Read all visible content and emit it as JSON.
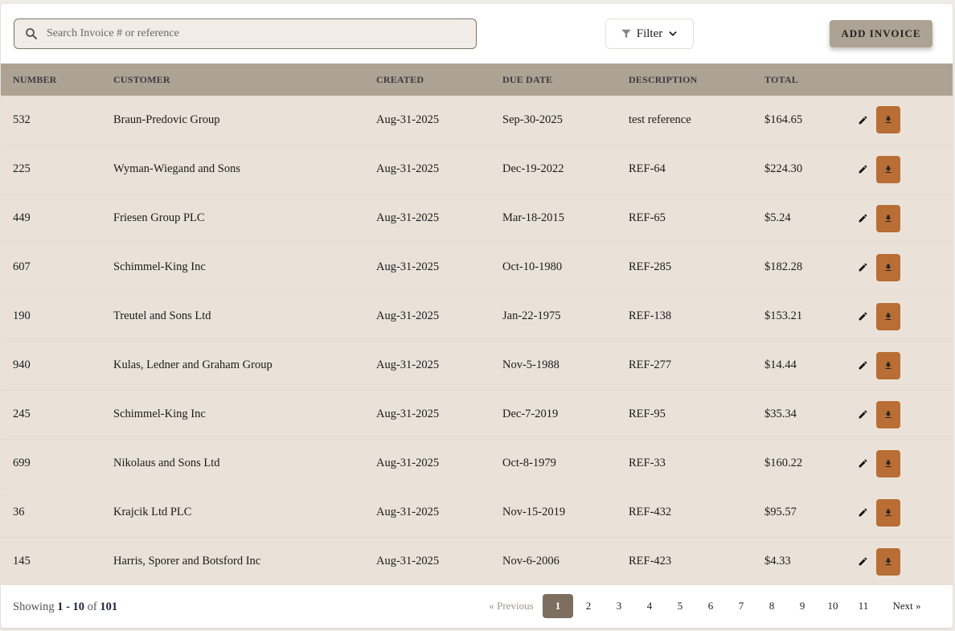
{
  "toolbar": {
    "search_placeholder": "Search Invoice # or reference",
    "filter_label": "Filter",
    "add_label": "ADD INVOICE"
  },
  "table": {
    "headers": [
      "NUMBER",
      "CUSTOMER",
      "CREATED",
      "DUE DATE",
      "DESCRIPTION",
      "TOTAL"
    ],
    "rows": [
      {
        "number": "532",
        "customer": "Braun-Predovic Group",
        "created": "Aug-31-2025",
        "due": "Sep-30-2025",
        "description": "test reference",
        "total": "$164.65"
      },
      {
        "number": "225",
        "customer": "Wyman-Wiegand and Sons",
        "created": "Aug-31-2025",
        "due": "Dec-19-2022",
        "description": "REF-64",
        "total": "$224.30"
      },
      {
        "number": "449",
        "customer": "Friesen Group PLC",
        "created": "Aug-31-2025",
        "due": "Mar-18-2015",
        "description": "REF-65",
        "total": "$5.24"
      },
      {
        "number": "607",
        "customer": "Schimmel-King Inc",
        "created": "Aug-31-2025",
        "due": "Oct-10-1980",
        "description": "REF-285",
        "total": "$182.28"
      },
      {
        "number": "190",
        "customer": "Treutel and Sons Ltd",
        "created": "Aug-31-2025",
        "due": "Jan-22-1975",
        "description": "REF-138",
        "total": "$153.21"
      },
      {
        "number": "940",
        "customer": "Kulas, Ledner and Graham Group",
        "created": "Aug-31-2025",
        "due": "Nov-5-1988",
        "description": "REF-277",
        "total": "$14.44"
      },
      {
        "number": "245",
        "customer": "Schimmel-King Inc",
        "created": "Aug-31-2025",
        "due": "Dec-7-2019",
        "description": "REF-95",
        "total": "$35.34"
      },
      {
        "number": "699",
        "customer": "Nikolaus and Sons Ltd",
        "created": "Aug-31-2025",
        "due": "Oct-8-1979",
        "description": "REF-33",
        "total": "$160.22"
      },
      {
        "number": "36",
        "customer": "Krajcik Ltd PLC",
        "created": "Aug-31-2025",
        "due": "Nov-15-2019",
        "description": "REF-432",
        "total": "$95.57"
      },
      {
        "number": "145",
        "customer": "Harris, Sporer and Botsford Inc",
        "created": "Aug-31-2025",
        "due": "Nov-6-2006",
        "description": "REF-423",
        "total": "$4.33"
      }
    ]
  },
  "footer": {
    "showing_prefix": "Showing",
    "range_start": "1",
    "range_sep": "-",
    "range_end": "10",
    "of_label": "of",
    "total": "101",
    "prev_label": "« Previous",
    "next_label": "Next »",
    "pages": [
      "1",
      "2",
      "3",
      "4",
      "5",
      "6",
      "7",
      "8",
      "9",
      "10",
      "11"
    ],
    "current_page": "1"
  },
  "colors": {
    "header_bg": "#ada394",
    "row_bg": "#eae2d8",
    "download_btn": "#b86e34",
    "active_page": "#7d6e60"
  },
  "icons": {
    "search": "search-icon",
    "filter": "filter-icon",
    "chevron": "chevron-down-icon",
    "edit": "pencil-icon",
    "download": "download-icon"
  }
}
